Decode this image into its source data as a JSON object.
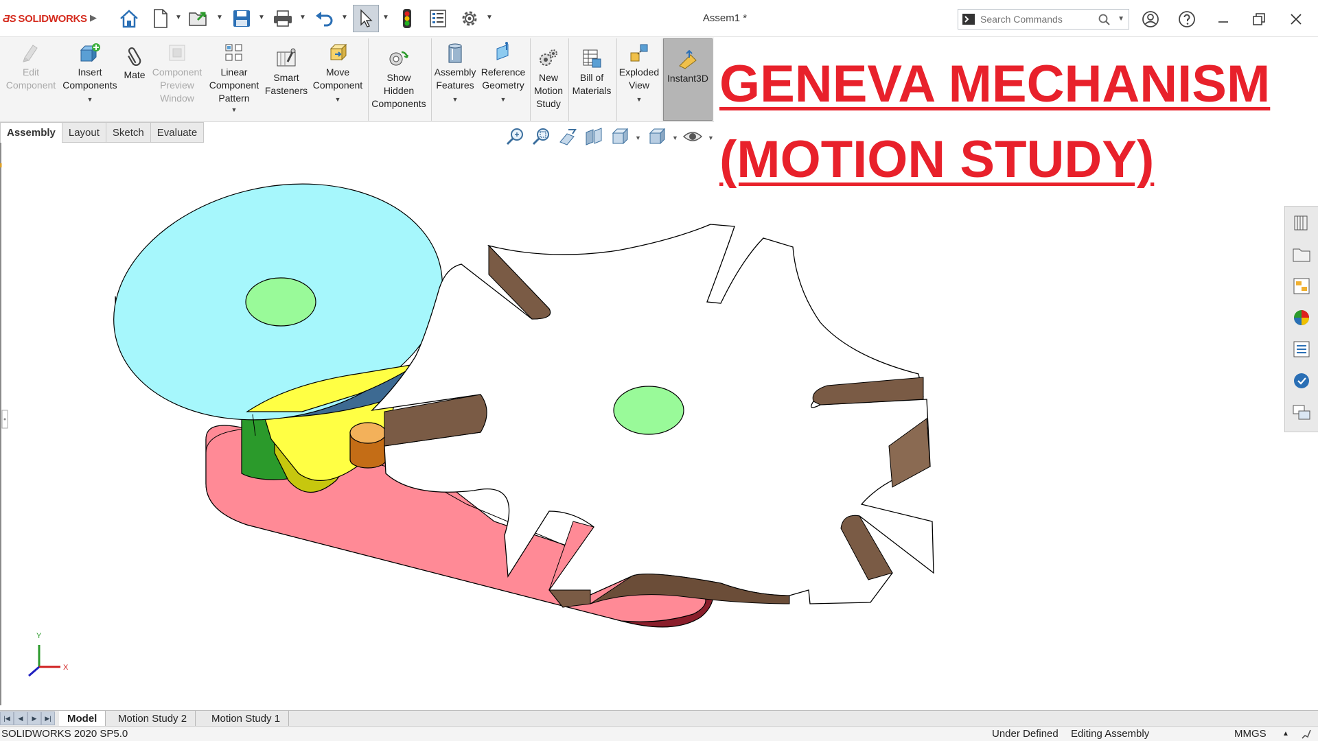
{
  "app": {
    "brand": "SOLIDWORKS",
    "document_title": "Assem1 *"
  },
  "search": {
    "placeholder": "Search Commands"
  },
  "commands": {
    "edit_component": [
      "Edit",
      "Component"
    ],
    "insert_components": [
      "Insert",
      "Components"
    ],
    "mate": [
      "Mate"
    ],
    "component_preview": [
      "Component",
      "Preview",
      "Window"
    ],
    "linear_pattern": [
      "Linear",
      "Component",
      "Pattern"
    ],
    "smart_fasteners": [
      "Smart",
      "Fasteners"
    ],
    "move_component": [
      "Move",
      "Component"
    ],
    "show_hidden": [
      "Show",
      "Hidden",
      "Components"
    ],
    "assembly_features": [
      "Assembly",
      "Features"
    ],
    "reference_geometry": [
      "Reference",
      "Geometry"
    ],
    "new_motion_study": [
      "New",
      "Motion",
      "Study"
    ],
    "bill_of_materials": [
      "Bill of",
      "Materials"
    ],
    "exploded_view": [
      "Exploded",
      "View"
    ],
    "instant3d": [
      "Instant3D"
    ]
  },
  "tabs": [
    "Assembly",
    "Layout",
    "Sketch",
    "Evaluate"
  ],
  "overlay": {
    "line1": "GENEVA MECHANISM",
    "line2": "(MOTION STUDY)"
  },
  "triad": {
    "x": "X",
    "y": "Y"
  },
  "bottom_tabs": [
    "Model",
    "Motion Study 2",
    "Motion Study 1"
  ],
  "status": {
    "version": "SOLIDWORKS 2020 SP5.0",
    "state": "Under Defined",
    "mode": "Editing Assembly",
    "units": "MMGS"
  },
  "colors": {
    "overlay_red": "#e8212b",
    "drive_disc": "#a6f7fc",
    "drive_disc_side": "#3d6a92",
    "base": "#ff8a96",
    "base_side": "#8a1e2b",
    "pin_hub": "#2b9a2b",
    "cam_lock": "#ffff44",
    "pin": "#f3b15a",
    "geneva_wheel": "#ffffff",
    "center_marks": "#99fa99",
    "slot_walls": "#7a5b45"
  }
}
